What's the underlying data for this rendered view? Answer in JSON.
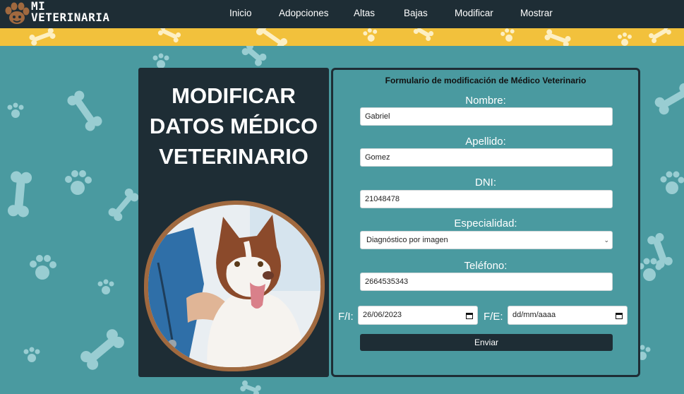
{
  "brand": {
    "line1": "MI",
    "line2": "VETERINARIA"
  },
  "nav": [
    {
      "label": "Inicio"
    },
    {
      "label": "Adopciones"
    },
    {
      "label": "Altas"
    },
    {
      "label": "Bajas"
    },
    {
      "label": "Modificar"
    },
    {
      "label": "Mostrar"
    }
  ],
  "hero": {
    "line1": "MODIFICAR",
    "line2": "DATOS MÉDICO",
    "line3": "VETERINARIO"
  },
  "form": {
    "heading": "Formulario de modificación de Médico Veterinario",
    "nombre_label": "Nombre:",
    "nombre_value": "Gabriel",
    "apellido_label": "Apellido:",
    "apellido_value": "Gomez",
    "dni_label": "DNI:",
    "dni_value": "21048478",
    "especialidad_label": "Especialidad:",
    "especialidad_value": "Diagnóstico por imagen",
    "telefono_label": "Teléfono:",
    "telefono_value": "2664535343",
    "fi_label": "F/I:",
    "fi_value": "26/06/2023",
    "fe_label": "F/E:",
    "fe_value": "dd/mm/aaaa",
    "submit_label": "Enviar"
  },
  "colors": {
    "dark": "#1e2d35",
    "teal": "#4a9aa0",
    "yellow": "#f2c13c",
    "decor": "#a8d6db",
    "photo_border": "#a0693f"
  }
}
